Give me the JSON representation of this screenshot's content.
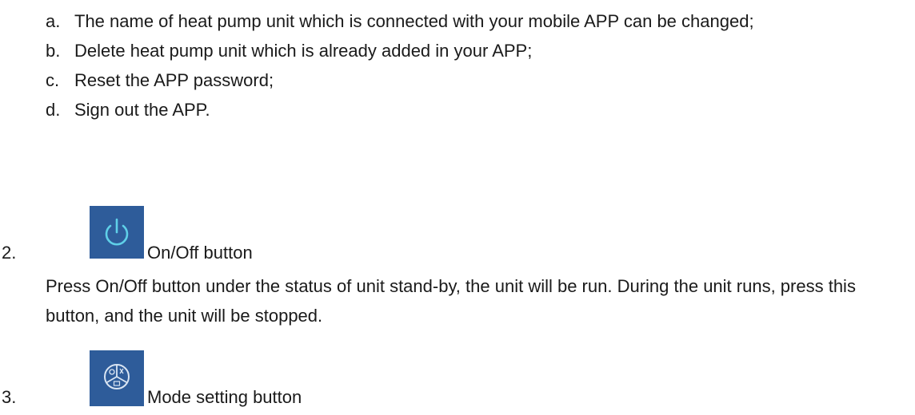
{
  "sub_items": [
    {
      "letter": "a.",
      "text": "The name of heat pump unit which is connected with your mobile APP can be changed;"
    },
    {
      "letter": "b.",
      "text": "Delete heat pump unit which is already added in your APP;"
    },
    {
      "letter": "c.",
      "text": "Reset the APP password;"
    },
    {
      "letter": "d.",
      "text": "Sign out the APP."
    }
  ],
  "items": [
    {
      "number": "2.",
      "icon": "power-icon",
      "label": "On/Off button",
      "description": "Press On/Off button under the status of unit stand-by, the unit will be run. During the unit runs, press this button, and the unit will be stopped."
    },
    {
      "number": "3.",
      "icon": "mode-icon",
      "label": "Mode setting button"
    }
  ],
  "colors": {
    "icon_background": "#2e5c9a",
    "icon_glyph": "#5fd0e8"
  }
}
